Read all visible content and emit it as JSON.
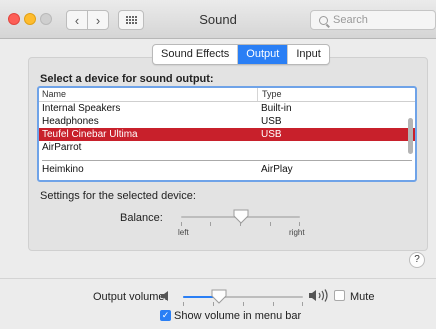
{
  "window": {
    "title": "Sound",
    "search_placeholder": "Search"
  },
  "tabs": [
    {
      "label": "Sound Effects",
      "active": false
    },
    {
      "label": "Output",
      "active": true
    },
    {
      "label": "Input",
      "active": false
    }
  ],
  "output": {
    "prompt": "Select a device for sound output:",
    "columns": [
      "Name",
      "Type"
    ],
    "devices": [
      {
        "name": "Internal Speakers",
        "type": "Built-in",
        "selected": false
      },
      {
        "name": "Headphones",
        "type": "USB",
        "selected": false
      },
      {
        "name": "Teufel Cinebar Ultima",
        "type": "USB",
        "selected": true
      },
      {
        "name": "AirParrot",
        "type": "",
        "selected": false
      },
      {
        "name": "Heimkino",
        "type": "AirPlay",
        "selected": false
      }
    ],
    "settings_label": "Settings for the selected device:",
    "balance_label": "Balance:",
    "balance_left": "left",
    "balance_right": "right",
    "balance_value": 0.5,
    "help": "?"
  },
  "volume": {
    "label": "Output volume:",
    "level": 0.3,
    "mute_label": "Mute",
    "mute_checked": false,
    "show_in_menu_label": "Show volume in menu bar",
    "show_in_menu_checked": true
  },
  "colors": {
    "accent": "#2a7ff5",
    "selection": "#c8202b"
  }
}
